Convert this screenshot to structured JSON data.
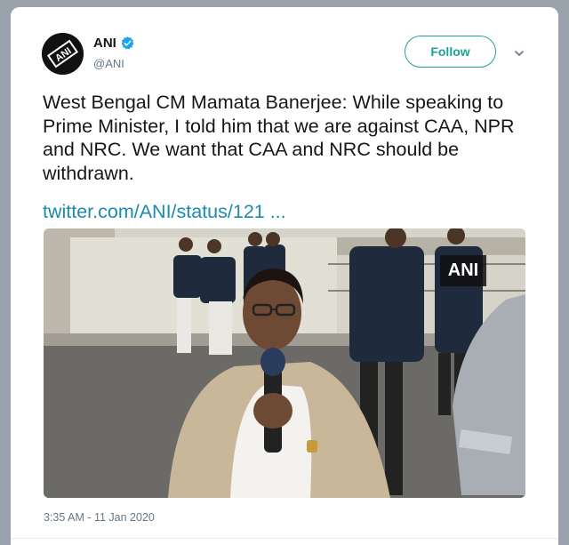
{
  "tweet": {
    "author_name": "ANI",
    "author_handle": "@ANI",
    "follow_label": "Follow",
    "text": "West Bengal CM Mamata Banerjee: While speaking to Prime Minister, I told him that we are against CAA, NPR and NRC. We want that CAA and NRC should be withdrawn.",
    "link_text": "twitter.com/ANI/status/121 ...",
    "timestamp": "3:35 AM - 11 Jan 2020",
    "media_watermark": "ANI",
    "avatar_text": "ANI"
  },
  "colors": {
    "accent": "#1ea196",
    "link": "#1a8ab0",
    "verified": "#1da1f2",
    "text": "#14171a",
    "muted": "#657786"
  },
  "icons": {
    "verified": "verified-badge-icon",
    "more": "chevron-down-icon"
  }
}
